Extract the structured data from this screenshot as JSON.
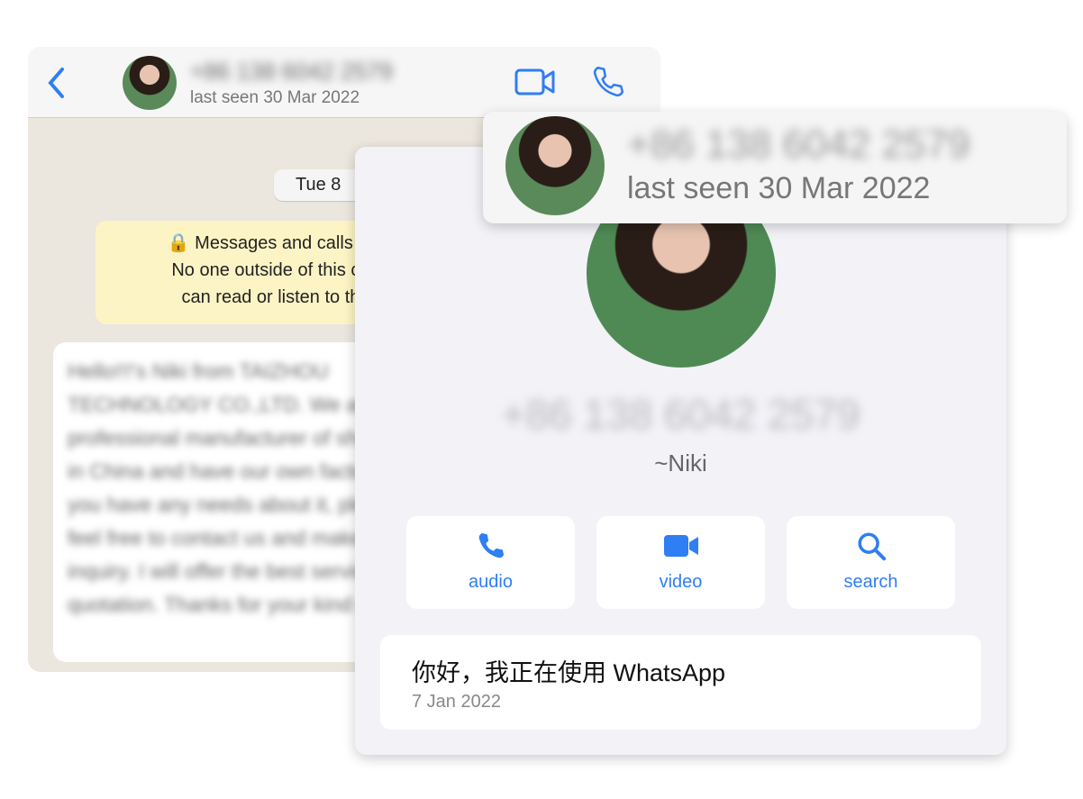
{
  "chat": {
    "contact_phone": "+86 138 6042 2579",
    "last_seen": "last seen 30 Mar 2022",
    "date_chip": "Tue 8",
    "encryption_notice": [
      "Messages and calls are",
      "No one outside of this cha",
      "can read or listen to the"
    ],
    "message": "Hello!!!'s Niki from TAIZHOU TECHNOLOGY CO.,LTD. We are professional manufacturer of sheets in China and have our own factory. If you have any needs about it, please feel free to contact us and make an inquiry. I will offer the best service and quotation. Thanks for your kind reply!"
  },
  "popup": {
    "phone": "+86 138 6042 2579",
    "last_seen": "last seen 30 Mar 2022"
  },
  "contact": {
    "phone": "+86 138 6042 2579",
    "nickname": "~Niki",
    "actions": [
      {
        "label": "audio",
        "icon": "phone-icon"
      },
      {
        "label": "video",
        "icon": "video-icon"
      },
      {
        "label": "search",
        "icon": "search-icon"
      }
    ],
    "about": "你好，我正在使用 WhatsApp",
    "about_date": "7 Jan 2022"
  },
  "colors": {
    "accent": "#2f7ef3",
    "notice_bg": "#fdf4c5",
    "panel_bg": "#f2f2f7"
  }
}
